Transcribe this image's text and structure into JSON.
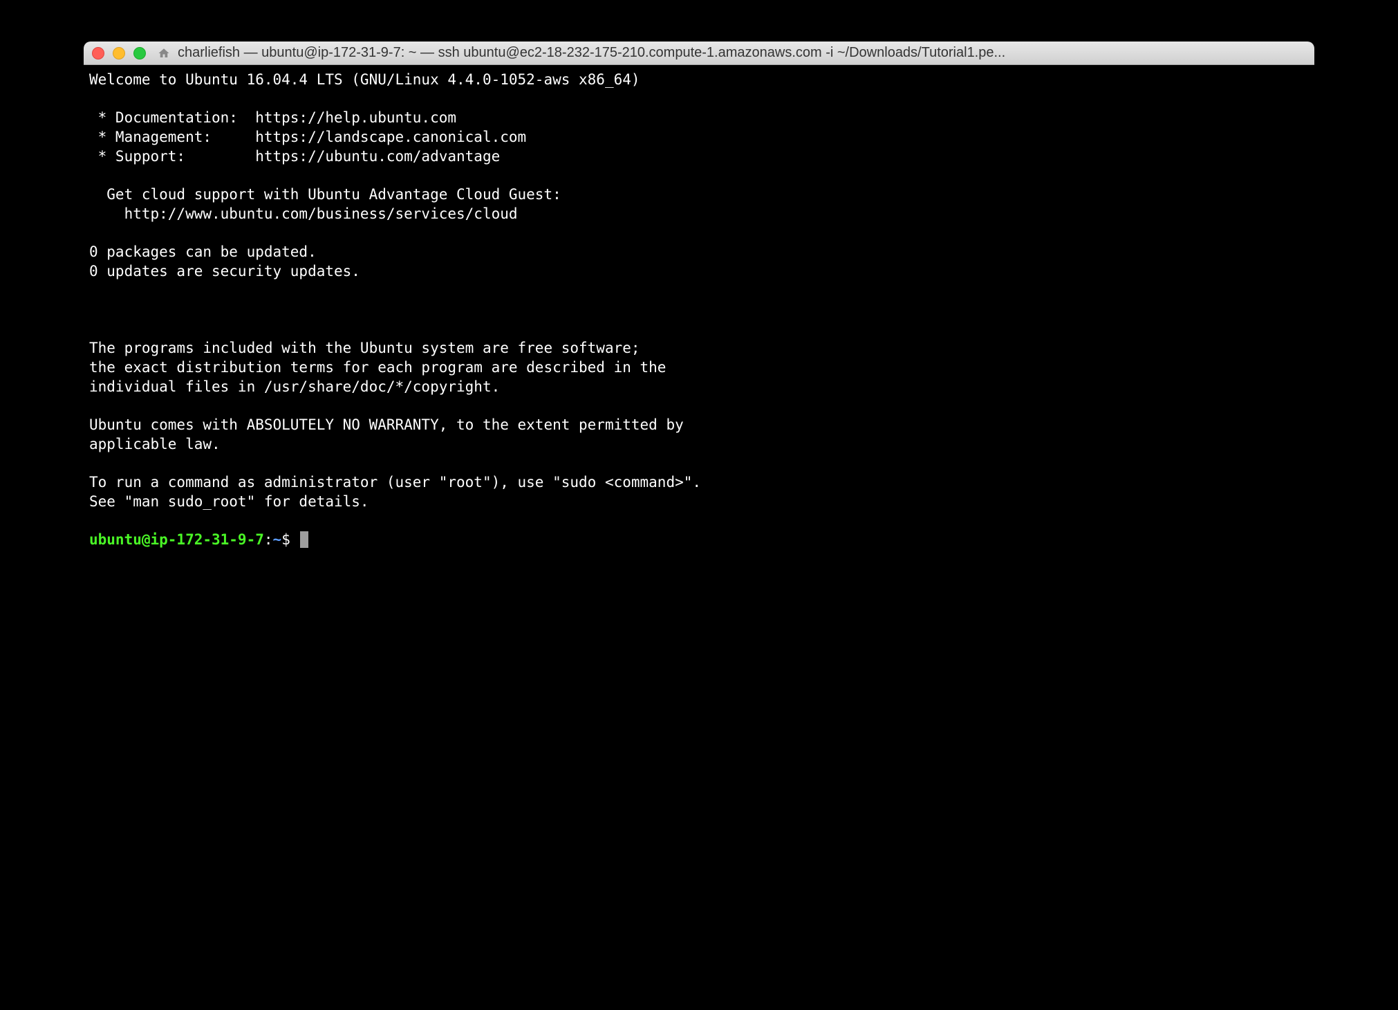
{
  "window": {
    "title": "charliefish — ubuntu@ip-172-31-9-7: ~ — ssh ubuntu@ec2-18-232-175-210.compute-1.amazonaws.com -i ~/Downloads/Tutorial1.pe..."
  },
  "motd": {
    "welcome": "Welcome to Ubuntu 16.04.4 LTS (GNU/Linux 4.4.0-1052-aws x86_64)",
    "blank1": "",
    "doc": " * Documentation:  https://help.ubuntu.com",
    "mgmt": " * Management:     https://landscape.canonical.com",
    "support": " * Support:        https://ubuntu.com/advantage",
    "blank2": "",
    "cloud1": "  Get cloud support with Ubuntu Advantage Cloud Guest:",
    "cloud2": "    http://www.ubuntu.com/business/services/cloud",
    "blank3": "",
    "pkg1": "0 packages can be updated.",
    "pkg2": "0 updates are security updates.",
    "blank4": "",
    "blank5": "",
    "blank6": "",
    "legal1": "The programs included with the Ubuntu system are free software;",
    "legal2": "the exact distribution terms for each program are described in the",
    "legal3": "individual files in /usr/share/doc/*/copyright.",
    "blank7": "",
    "warranty1": "Ubuntu comes with ABSOLUTELY NO WARRANTY, to the extent permitted by",
    "warranty2": "applicable law.",
    "blank8": "",
    "sudo1": "To run a command as administrator (user \"root\"), use \"sudo <command>\".",
    "sudo2": "See \"man sudo_root\" for details.",
    "blank9": ""
  },
  "prompt": {
    "user_host": "ubuntu@ip-172-31-9-7",
    "colon": ":",
    "path": "~",
    "dollar": "$ "
  }
}
